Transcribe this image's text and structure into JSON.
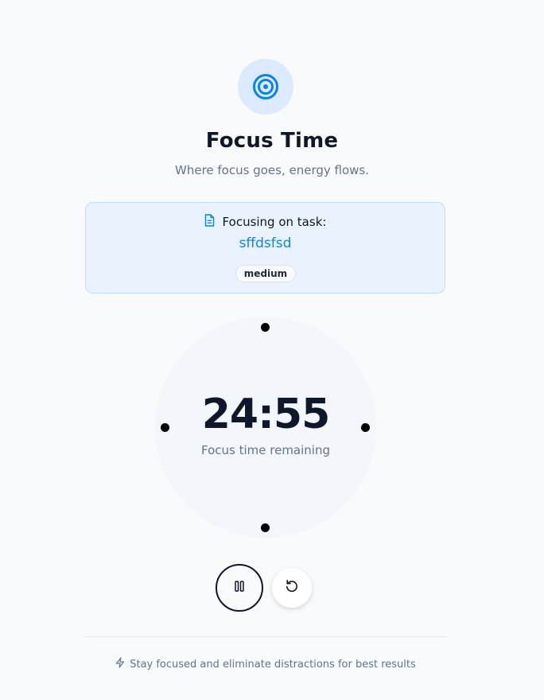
{
  "header": {
    "icon": "target-icon",
    "title": "Focus Time",
    "subtitle": "Where focus goes, energy flows."
  },
  "task": {
    "icon": "document-icon",
    "heading": "Focusing on task:",
    "name": "sffdsfsd",
    "priority": "medium"
  },
  "timer": {
    "time": "24:55",
    "caption": "Focus time remaining"
  },
  "controls": {
    "pause_icon": "pause-icon",
    "reset_icon": "reset-icon"
  },
  "footer": {
    "icon": "lightning-icon",
    "tip": "Stay focused and eliminate distractions for best results"
  },
  "colors": {
    "accent": "#0b84e3",
    "background": "#f8fafc",
    "card": "#eaf3fd",
    "text": "#0f172a",
    "muted": "#64748b"
  }
}
